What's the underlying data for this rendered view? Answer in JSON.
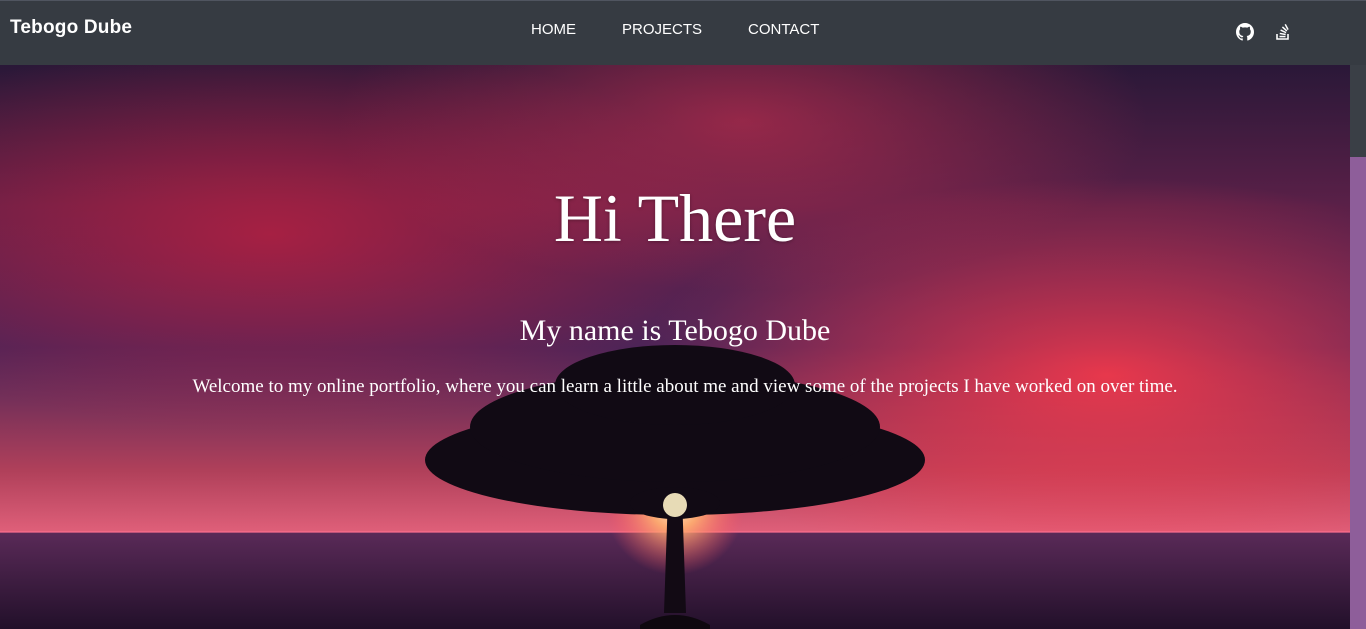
{
  "navbar": {
    "brand": "Tebogo Dube",
    "links": [
      {
        "label": "HOME"
      },
      {
        "label": "PROJECTS"
      },
      {
        "label": "CONTACT"
      }
    ],
    "icons": [
      "github-icon",
      "stack-overflow-icon"
    ]
  },
  "hero": {
    "title": "Hi There",
    "subtitle": "My name is Tebogo Dube",
    "text": "Welcome to my online portfolio, where you can learn a little about me and view some of the projects I have worked on over time."
  },
  "colors": {
    "navbar": "#363b42",
    "scrollbar_track": "#8e5e9a",
    "text": "#ffffff"
  }
}
